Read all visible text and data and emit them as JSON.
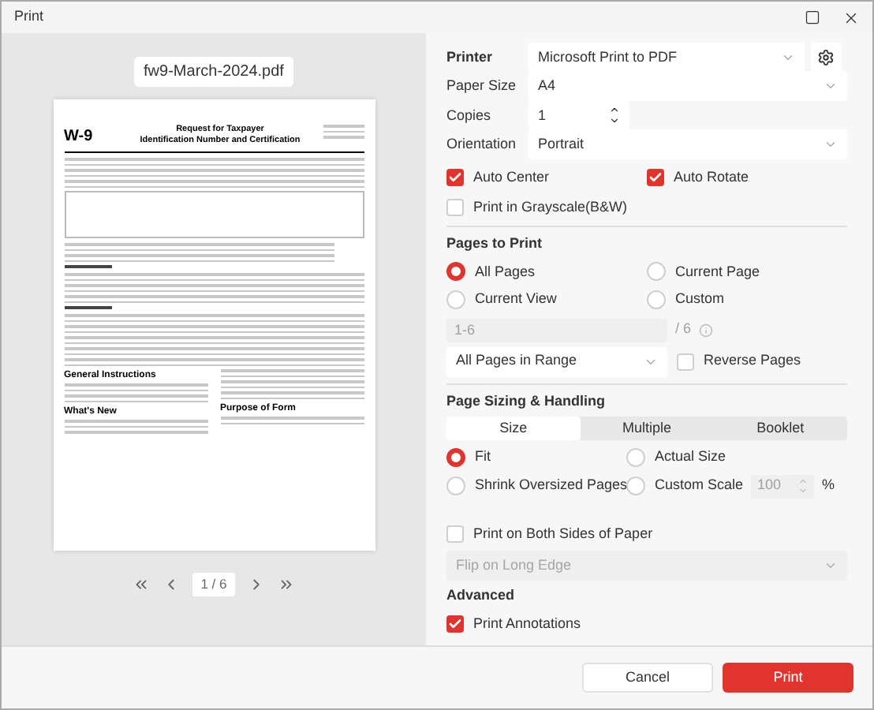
{
  "window": {
    "title": "Print"
  },
  "preview": {
    "file_name": "fw9-March-2024.pdf",
    "page": {
      "form_number": "W-9",
      "title_lines": [
        "Request for Taxpayer",
        "Identification Number and Certification"
      ],
      "headings": [
        "General Instructions",
        "What's New",
        "Purpose of Form"
      ]
    },
    "pager": {
      "page": "1 / 6"
    }
  },
  "settings": {
    "fields": [
      {
        "kind": "printer",
        "label": "Printer",
        "value": "Microsoft Print to PDF"
      },
      {
        "kind": "dropdown",
        "label": "Paper Size",
        "value": "A4"
      },
      {
        "kind": "spinner",
        "label": "Copies",
        "value": "1"
      },
      {
        "kind": "dropdown",
        "label": "Orientation",
        "value": "Portrait"
      }
    ],
    "options": [
      {
        "label": "Auto Center",
        "checked": true
      },
      {
        "label": "Auto Rotate",
        "checked": true
      },
      {
        "label": "Print in Grayscale(B&W)",
        "checked": false
      }
    ],
    "pages_to_print": {
      "heading": "Pages to Print",
      "choices": [
        {
          "label": "All Pages",
          "selected": true
        },
        {
          "label": "Current Page",
          "selected": false
        },
        {
          "label": "Current View",
          "selected": false
        },
        {
          "label": "Custom",
          "selected": false
        }
      ],
      "range": {
        "placeholder": "1-6",
        "disabled": true,
        "total": "/ 6"
      },
      "subset": {
        "value": "All Pages in Range"
      },
      "reverse": {
        "label": "Reverse Pages",
        "checked": false
      }
    },
    "sizing": {
      "heading": "Page Sizing & Handling",
      "tabs": [
        {
          "label": "Size",
          "selected": true
        },
        {
          "label": "Multiple",
          "selected": false
        },
        {
          "label": "Booklet",
          "selected": false
        }
      ],
      "choices": [
        {
          "label": "Fit",
          "selected": true
        },
        {
          "label": "Actual Size",
          "selected": false
        },
        {
          "label": "Shrink Oversized Pages",
          "selected": false
        },
        {
          "label": "Custom Scale",
          "selected": false
        }
      ],
      "scale": {
        "value": "100",
        "disabled": true,
        "unit": "%"
      }
    },
    "duplex": {
      "label": "Print on Both Sides of Paper",
      "checked": false,
      "flip": {
        "value": "Flip on Long Edge",
        "disabled": true
      }
    },
    "advanced": {
      "heading": "Advanced",
      "options": [
        {
          "label": "Print Annotations",
          "checked": true
        }
      ]
    }
  },
  "buttons": [
    {
      "label": "Cancel",
      "kind": "secondary"
    },
    {
      "label": "Print",
      "kind": "primary"
    }
  ]
}
